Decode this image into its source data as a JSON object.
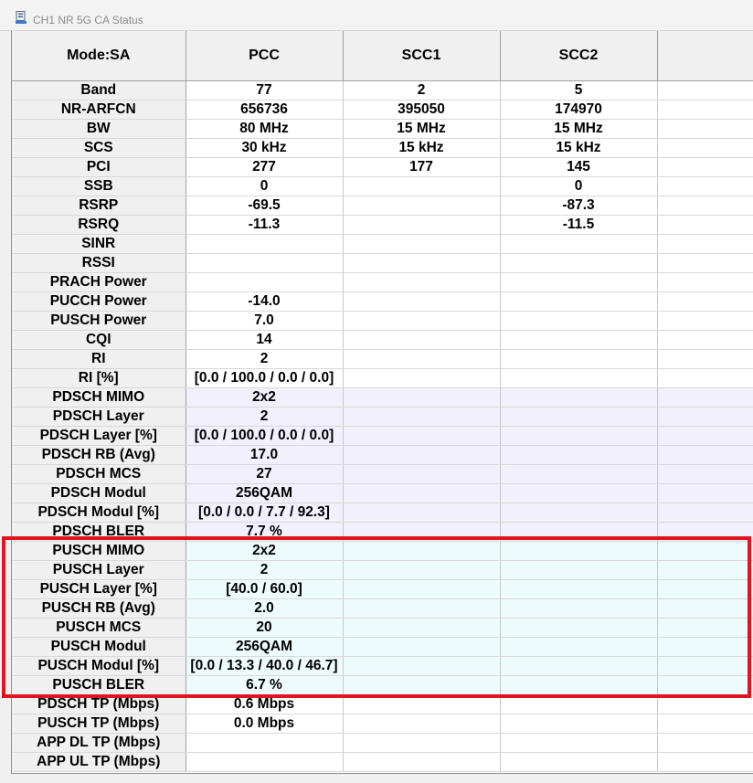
{
  "window": {
    "title": "CH1 NR 5G CA Status",
    "icon": "app-icon"
  },
  "header": {
    "mode": "Mode:SA",
    "columns": [
      "PCC",
      "SCC1",
      "SCC2",
      ""
    ]
  },
  "rows": [
    {
      "label": "Band",
      "values": [
        "77",
        "2",
        "5",
        ""
      ],
      "group": "gen"
    },
    {
      "label": "NR-ARFCN",
      "values": [
        "656736",
        "395050",
        "174970",
        ""
      ],
      "group": "gen"
    },
    {
      "label": "BW",
      "values": [
        "80 MHz",
        "15 MHz",
        "15 MHz",
        ""
      ],
      "group": "gen"
    },
    {
      "label": "SCS",
      "values": [
        "30 kHz",
        "15 kHz",
        "15 kHz",
        ""
      ],
      "group": "gen"
    },
    {
      "label": "PCI",
      "values": [
        "277",
        "177",
        "145",
        ""
      ],
      "group": "gen"
    },
    {
      "label": "SSB",
      "values": [
        "0",
        "",
        "0",
        ""
      ],
      "group": "gen"
    },
    {
      "label": "RSRP",
      "values": [
        "-69.5",
        "",
        "-87.3",
        ""
      ],
      "group": "gen"
    },
    {
      "label": "RSRQ",
      "values": [
        "-11.3",
        "",
        "-11.5",
        ""
      ],
      "group": "gen"
    },
    {
      "label": "SINR",
      "values": [
        "",
        "",
        "",
        ""
      ],
      "group": "gen"
    },
    {
      "label": "RSSI",
      "values": [
        "",
        "",
        "",
        ""
      ],
      "group": "gen"
    },
    {
      "label": "PRACH Power",
      "values": [
        "",
        "",
        "",
        ""
      ],
      "group": "gen"
    },
    {
      "label": "PUCCH Power",
      "values": [
        "-14.0",
        "",
        "",
        ""
      ],
      "group": "gen"
    },
    {
      "label": "PUSCH Power",
      "values": [
        "7.0",
        "",
        "",
        ""
      ],
      "group": "gen"
    },
    {
      "label": "CQI",
      "values": [
        "14",
        "",
        "",
        ""
      ],
      "group": "gen"
    },
    {
      "label": "RI",
      "values": [
        "2",
        "",
        "",
        ""
      ],
      "group": "gen"
    },
    {
      "label": "RI [%]",
      "values": [
        "[0.0 / 100.0 / 0.0 / 0.0]",
        "",
        "",
        ""
      ],
      "group": "gen"
    },
    {
      "label": "PDSCH MIMO",
      "values": [
        "2x2",
        "",
        "",
        ""
      ],
      "group": "pdsch"
    },
    {
      "label": "PDSCH Layer",
      "values": [
        "2",
        "",
        "",
        ""
      ],
      "group": "pdsch"
    },
    {
      "label": "PDSCH Layer [%]",
      "values": [
        "[0.0 / 100.0 / 0.0 / 0.0]",
        "",
        "",
        ""
      ],
      "group": "pdsch"
    },
    {
      "label": "PDSCH RB (Avg)",
      "values": [
        "17.0",
        "",
        "",
        ""
      ],
      "group": "pdsch"
    },
    {
      "label": "PDSCH MCS",
      "values": [
        "27",
        "",
        "",
        ""
      ],
      "group": "pdsch"
    },
    {
      "label": "PDSCH Modul",
      "values": [
        "256QAM",
        "",
        "",
        ""
      ],
      "group": "pdsch"
    },
    {
      "label": "PDSCH Modul [%]",
      "values": [
        "[0.0 / 0.0 / 7.7 / 92.3]",
        "",
        "",
        ""
      ],
      "group": "pdsch"
    },
    {
      "label": "PDSCH BLER",
      "values": [
        "7.7 %",
        "",
        "",
        ""
      ],
      "group": "pdsch"
    },
    {
      "label": "PUSCH MIMO",
      "values": [
        "2x2",
        "",
        "",
        ""
      ],
      "group": "pusch"
    },
    {
      "label": "PUSCH Layer",
      "values": [
        "2",
        "",
        "",
        ""
      ],
      "group": "pusch"
    },
    {
      "label": "PUSCH Layer [%]",
      "values": [
        "[40.0 / 60.0]",
        "",
        "",
        ""
      ],
      "group": "pusch"
    },
    {
      "label": "PUSCH RB (Avg)",
      "values": [
        "2.0",
        "",
        "",
        ""
      ],
      "group": "pusch"
    },
    {
      "label": "PUSCH MCS",
      "values": [
        "20",
        "",
        "",
        ""
      ],
      "group": "pusch"
    },
    {
      "label": "PUSCH Modul",
      "values": [
        "256QAM",
        "",
        "",
        ""
      ],
      "group": "pusch"
    },
    {
      "label": "PUSCH Modul [%]",
      "values": [
        "[0.0 / 13.3 / 40.0 / 46.7]",
        "",
        "",
        ""
      ],
      "group": "pusch"
    },
    {
      "label": "PUSCH BLER",
      "values": [
        "6.7 %",
        "",
        "",
        ""
      ],
      "group": "pusch"
    },
    {
      "label": "PDSCH TP (Mbps)",
      "values": [
        "0.6 Mbps",
        "",
        "",
        ""
      ],
      "group": "gen"
    },
    {
      "label": "PUSCH TP (Mbps)",
      "values": [
        "0.0 Mbps",
        "",
        "",
        ""
      ],
      "group": "gen"
    },
    {
      "label": "APP DL TP (Mbps)",
      "values": [
        "",
        "",
        "",
        ""
      ],
      "group": "gen"
    },
    {
      "label": "APP UL TP (Mbps)",
      "values": [
        "",
        "",
        "",
        ""
      ],
      "group": "gen"
    }
  ],
  "colors": {
    "highlight": "#e0141e",
    "pdsch_bg": "#f1f0fc",
    "pusch_bg": "#eefbfc",
    "header_bg": "#f0f0f0"
  }
}
